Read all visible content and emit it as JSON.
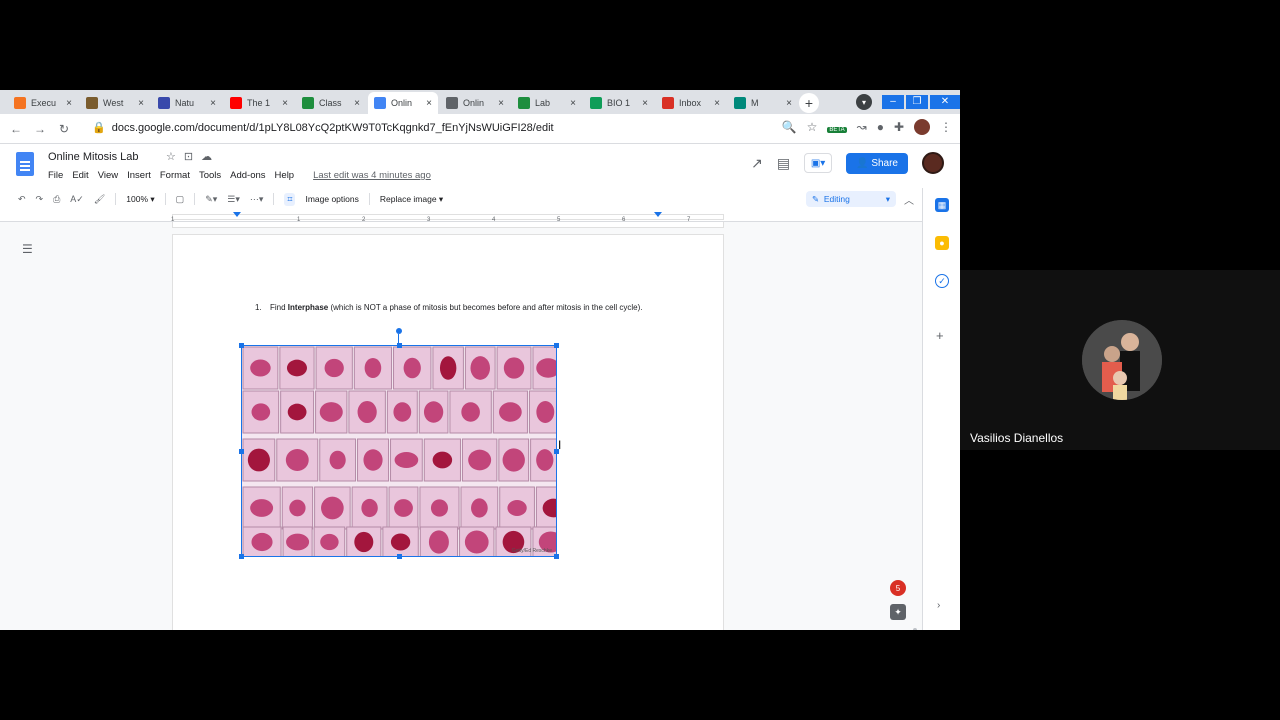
{
  "browser": {
    "tabs": [
      {
        "label": "Execu",
        "icon": "university-icon",
        "color": "#f47321"
      },
      {
        "label": "West",
        "icon": "west-icon",
        "color": "#7a5c2e"
      },
      {
        "label": "Natu",
        "icon": "nature-icon",
        "color": "#3949ab"
      },
      {
        "label": "The 1",
        "icon": "youtube-icon",
        "color": "#ff0000"
      },
      {
        "label": "Class",
        "icon": "classroom-icon",
        "color": "#1e8e3e"
      },
      {
        "label": "Onlin",
        "icon": "docs-icon",
        "color": "#4285f4",
        "active": true
      },
      {
        "label": "Onlin",
        "icon": "globe-icon",
        "color": "#5f6368"
      },
      {
        "label": "Lab",
        "icon": "classroom-icon",
        "color": "#1e8e3e"
      },
      {
        "label": "BIO 1",
        "icon": "sheets-icon",
        "color": "#0f9d58"
      },
      {
        "label": "Inbox",
        "icon": "gmail-icon",
        "color": "#d93025"
      },
      {
        "label": "M",
        "icon": "meet-icon",
        "color": "#00897b"
      }
    ],
    "url": "docs.google.com/document/d/1pLY8L08YcQ2ptKW9T0TcKqgnkd7_fEnYjNsWUiGFI28/edit",
    "beta_label": "BETA"
  },
  "docs": {
    "title": "Online Mitosis Lab",
    "menu": [
      "File",
      "Edit",
      "View",
      "Insert",
      "Format",
      "Tools",
      "Add-ons",
      "Help"
    ],
    "last_edit": "Last edit was 4 minutes ago",
    "share_label": "Share",
    "toolbar": {
      "zoom": "100%",
      "image_options": "Image options",
      "replace_image": "Replace image",
      "mode": "Editing"
    },
    "ruler_numbers": [
      "1",
      "1",
      "2",
      "3",
      "4",
      "5",
      "6",
      "7"
    ]
  },
  "document": {
    "list_number": "1.",
    "item_prefix": "Find ",
    "item_bold": "Interphase",
    "item_rest": " (which is NOT a phase of mitosis but becomes before and after mitosis in the cell cycle).",
    "image_credit": "Getty/Ed Reschke"
  },
  "notifications": {
    "count": "5"
  },
  "meeting": {
    "participant_name": "Vasilios Dianellos"
  }
}
